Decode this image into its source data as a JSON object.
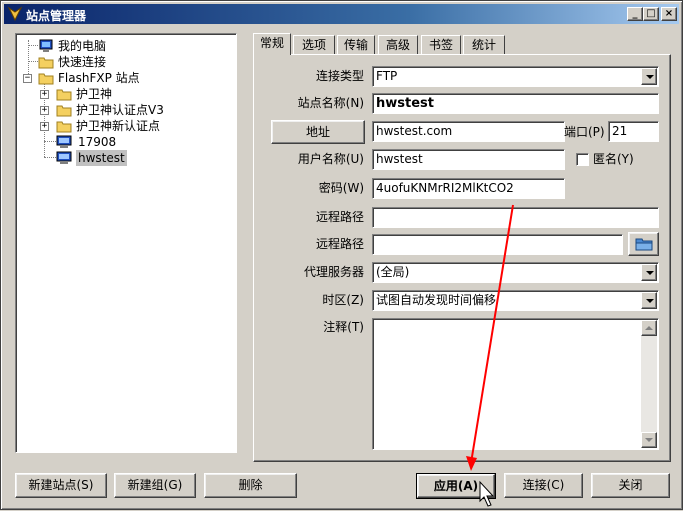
{
  "window": {
    "title": "站点管理器",
    "controls": [
      "_",
      "□",
      "×"
    ]
  },
  "tree": {
    "items": [
      {
        "label": "我的电脑",
        "icon": "computer-icon"
      },
      {
        "label": "快速连接",
        "icon": "folder-icon"
      },
      {
        "label": "FlashFXP 站点",
        "icon": "folder-icon",
        "expander": "−"
      },
      {
        "label": "护卫神",
        "icon": "folder-icon",
        "expander": "+"
      },
      {
        "label": "护卫神认证点V3",
        "icon": "folder-icon",
        "expander": "+"
      },
      {
        "label": "护卫神新认证点",
        "icon": "folder-icon",
        "expander": "+"
      },
      {
        "label": "17908",
        "icon": "monitor-icon"
      },
      {
        "label": "hwstest",
        "icon": "monitor-icon",
        "selected": true
      }
    ]
  },
  "tabs": [
    "常规",
    "选项",
    "传输",
    "高级",
    "书签",
    "统计"
  ],
  "form": {
    "connection_type_label": "连接类型",
    "connection_type_value": "FTP",
    "site_name_label": "站点名称(N)",
    "site_name_value": "hwstest",
    "address_button": "地址",
    "address_value": "hwstest.com",
    "port_label": "端口(P)",
    "port_value": "21",
    "username_label": "用户名称(U)",
    "username_value": "hwstest",
    "anonymous_label": "匿名(Y)",
    "password_label": "密码(W)",
    "password_value": "4uofuKNMrRI2MlKtCO2",
    "remote_path_label": "远程路径",
    "remote_path_value": "",
    "local_path_label": "远程路径",
    "local_path_value": "",
    "proxy_label": "代理服务器",
    "proxy_value": "(全局)",
    "timezone_label": "时区(Z)",
    "timezone_value": "试图自动发现时间偏移",
    "notes_label": "注释(T)",
    "notes_value": ""
  },
  "buttons": {
    "new_site": "新建站点(S)",
    "new_group": "新建组(G)",
    "delete": "删除",
    "apply": "应用(A)",
    "connect": "连接(C)",
    "close": "关闭"
  },
  "colors": {
    "titlebar": "#0a246a",
    "selection": "#c0c0c0",
    "arrow": "#ff0000"
  }
}
